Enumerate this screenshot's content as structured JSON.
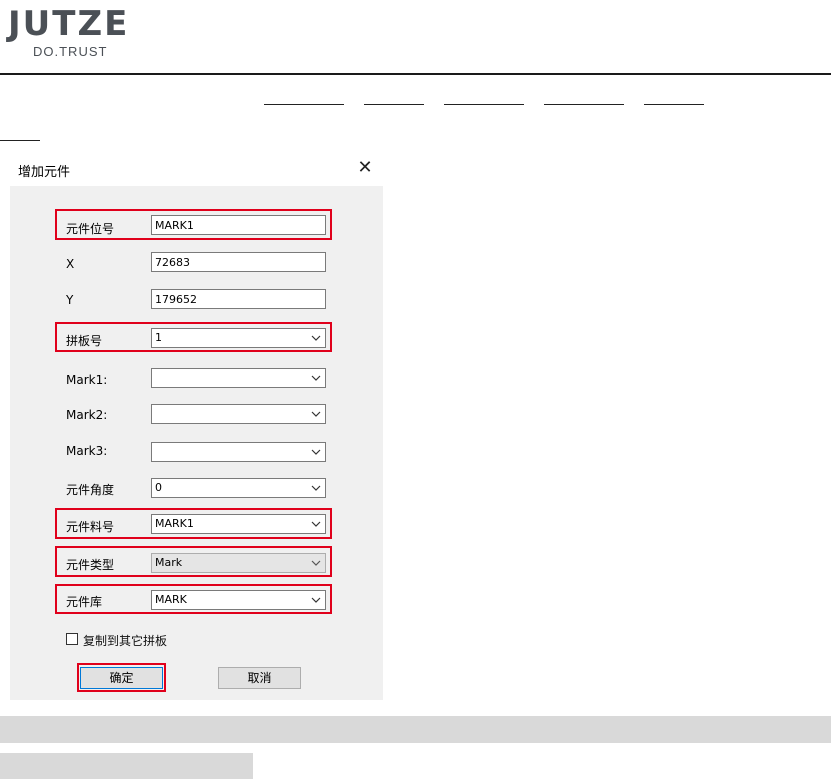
{
  "logo": {
    "brand": "JUTZE",
    "tagline": "DO.TRUST"
  },
  "dialog": {
    "title": "增加元件",
    "close_glyph": "✕",
    "fields": {
      "ref": {
        "label": "元件位号",
        "value": "MARK1"
      },
      "x": {
        "label": "X",
        "value": "72683"
      },
      "y": {
        "label": "Y",
        "value": "179652"
      },
      "panel": {
        "label": "拼板号",
        "value": "1"
      },
      "mark1": {
        "label": "Mark1:",
        "value": ""
      },
      "mark2": {
        "label": "Mark2:",
        "value": ""
      },
      "mark3": {
        "label": "Mark3:",
        "value": ""
      },
      "angle": {
        "label": "元件角度",
        "value": "0"
      },
      "part_no": {
        "label": "元件料号",
        "value": "MARK1"
      },
      "type": {
        "label": "元件类型",
        "value": "Mark"
      },
      "library": {
        "label": "元件库",
        "value": "MARK"
      }
    },
    "copy_checkbox": {
      "label": "复制到其它拼板",
      "checked": false
    },
    "ok_label": "确定",
    "cancel_label": "取消"
  },
  "colors": {
    "highlight": "#e0001b",
    "dialog_bg": "#f0f0f0",
    "button_focus": "#0078d7"
  }
}
